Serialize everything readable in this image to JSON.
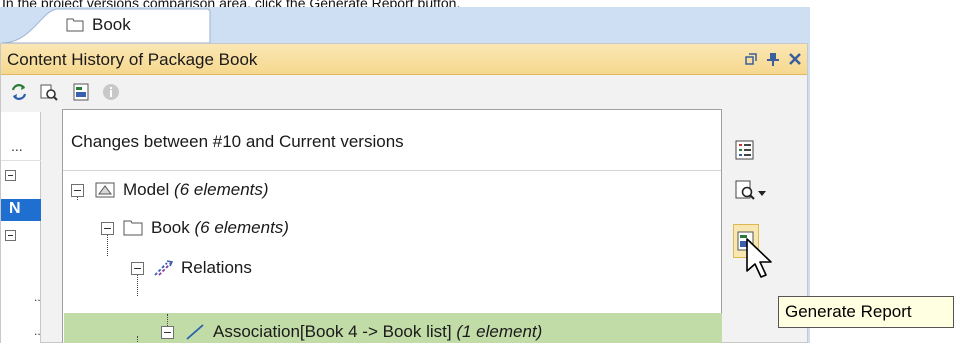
{
  "instruction": "In the project versions comparison area, click the Generate Report button.",
  "tab": {
    "label": "Book",
    "icon": "package-icon"
  },
  "panel": {
    "title": "Content History of Package Book",
    "header_buttons": [
      "restore-icon",
      "pin-icon",
      "close-icon"
    ]
  },
  "toolbar": {
    "buttons": [
      "refresh-icon",
      "compare-icon",
      "generate-report-icon",
      "info-icon"
    ]
  },
  "left_strip": {
    "column_header": "...",
    "selected_text": "N"
  },
  "tree": {
    "header": "Changes between #10 and Current versions",
    "rows": [
      {
        "name": "Model",
        "count": "(6 elements)",
        "icon": "model-icon"
      },
      {
        "name": "Book",
        "count": "(6 elements)",
        "icon": "package-icon"
      },
      {
        "name": "Relations",
        "count": "",
        "icon": "relations-icon"
      },
      {
        "name": "Association[Book 4 -> Book list]",
        "count": "(1 element)",
        "icon": "association-icon"
      }
    ]
  },
  "side_tools": [
    "list-icon",
    "search-document-icon",
    "generate-report-icon"
  ],
  "tooltip": {
    "text": "Generate Report"
  },
  "colors": {
    "tab_bar": "#cfdff3",
    "panel_header": "#f6d88e",
    "selected_row": "#1f6fd0",
    "highlight_row": "#c2dca8",
    "tooltip_bg": "#ffffe1"
  }
}
